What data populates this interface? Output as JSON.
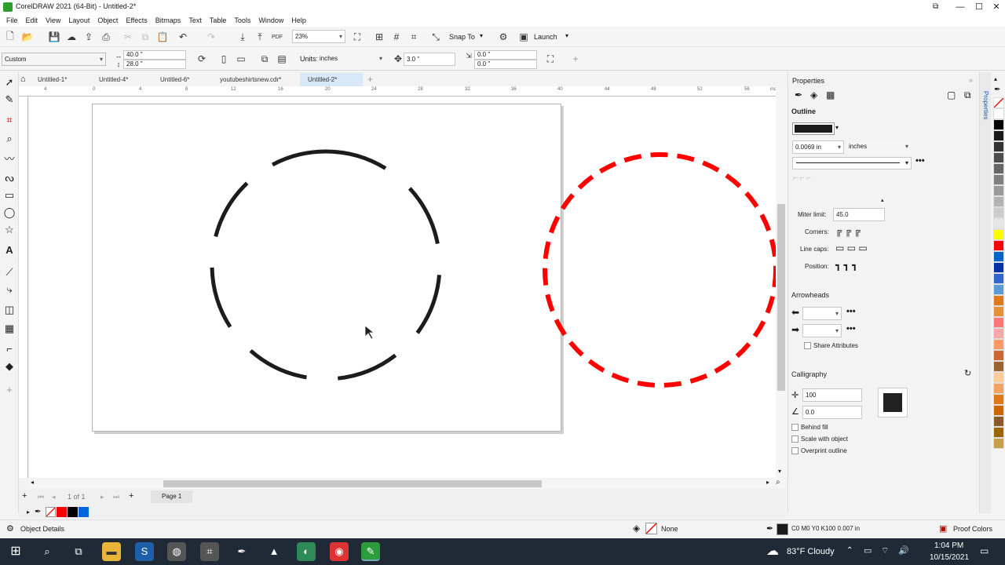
{
  "window": {
    "title": "CorelDRAW 2021 (64-Bit) - Untitled-2*",
    "minimize": "—",
    "maximize": "☐",
    "close": "✕"
  },
  "menu": [
    "File",
    "Edit",
    "View",
    "Layout",
    "Object",
    "Effects",
    "Bitmaps",
    "Text",
    "Table",
    "Tools",
    "Window",
    "Help"
  ],
  "toolbar": {
    "zoom": "23%",
    "snap_to": "Snap To",
    "launch": "Launch"
  },
  "property_bar": {
    "preset": "Custom",
    "width": "40.0 \"",
    "height": "28.0 \"",
    "units_label": "Units:",
    "units_value": "inches",
    "nudge": "3.0 \"",
    "dup_x": "0.0 \"",
    "dup_y": "0.0 \""
  },
  "doc_tabs": [
    {
      "label": "Untitled-1*",
      "active": false
    },
    {
      "label": "Untitled-4*",
      "active": false
    },
    {
      "label": "Untitled-6*",
      "active": false
    },
    {
      "label": "youtubeshirtsnew.cdr*",
      "active": false
    },
    {
      "label": "Untitled-2*",
      "active": true
    }
  ],
  "ruler": {
    "unit": "inches",
    "ticks": [
      "4",
      "0",
      "4",
      "8",
      "12",
      "16",
      "20",
      "24",
      "28",
      "32",
      "36",
      "40",
      "44",
      "48",
      "52",
      "56",
      "60",
      "64"
    ]
  },
  "page_nav": {
    "count": "1 of 1",
    "page_tab": "Page 1"
  },
  "properties": {
    "title": "Properties",
    "outline_header": "Outline",
    "outline_color": "#1a1a1a",
    "width_value": "0.0069 in",
    "width_units": "inches",
    "miter_label": "Miter limit:",
    "miter_value": "45.0",
    "corners_label": "Corners:",
    "linecaps_label": "Line caps:",
    "position_label": "Position:",
    "arrowheads_header": "Arrowheads",
    "share_attributes": "Share Attributes",
    "calligraphy_header": "Calligraphy",
    "stretch_value": "100",
    "angle_value": "0.0",
    "behind_fill": "Behind fill",
    "scale_with_object": "Scale with object",
    "overprint_outline": "Overprint outline",
    "side_tab": "Properties"
  },
  "palette_colors": [
    "#ffffff",
    "#000000",
    "#1a1a1a",
    "#333333",
    "#4d4d4d",
    "#666666",
    "#808080",
    "#999999",
    "#b3b3b3",
    "#cccccc",
    "#e6e6e6",
    "#ffff00",
    "#ff0000",
    "#0066cc",
    "#0033aa",
    "#3366cc",
    "#5b9bd5",
    "#e07a18",
    "#e69138",
    "#ff7777",
    "#f4a8a8",
    "#ff9966",
    "#cc6633",
    "#996633",
    "#ffcc99",
    "#f4a460",
    "#e07a18",
    "#cc6600",
    "#8b5a2b",
    "#996600",
    "#c8a04a"
  ],
  "document_palette": [
    "#ff0000",
    "#000000",
    "#0066dd"
  ],
  "status": {
    "object_details": "Object Details",
    "fill": "None",
    "outline": "C0 M0 Y0 K100  0.007 in",
    "proof": "Proof Colors"
  },
  "taskbar": {
    "weather": "83°F  Cloudy",
    "time": "1:04 PM",
    "date": "10/15/2021"
  }
}
